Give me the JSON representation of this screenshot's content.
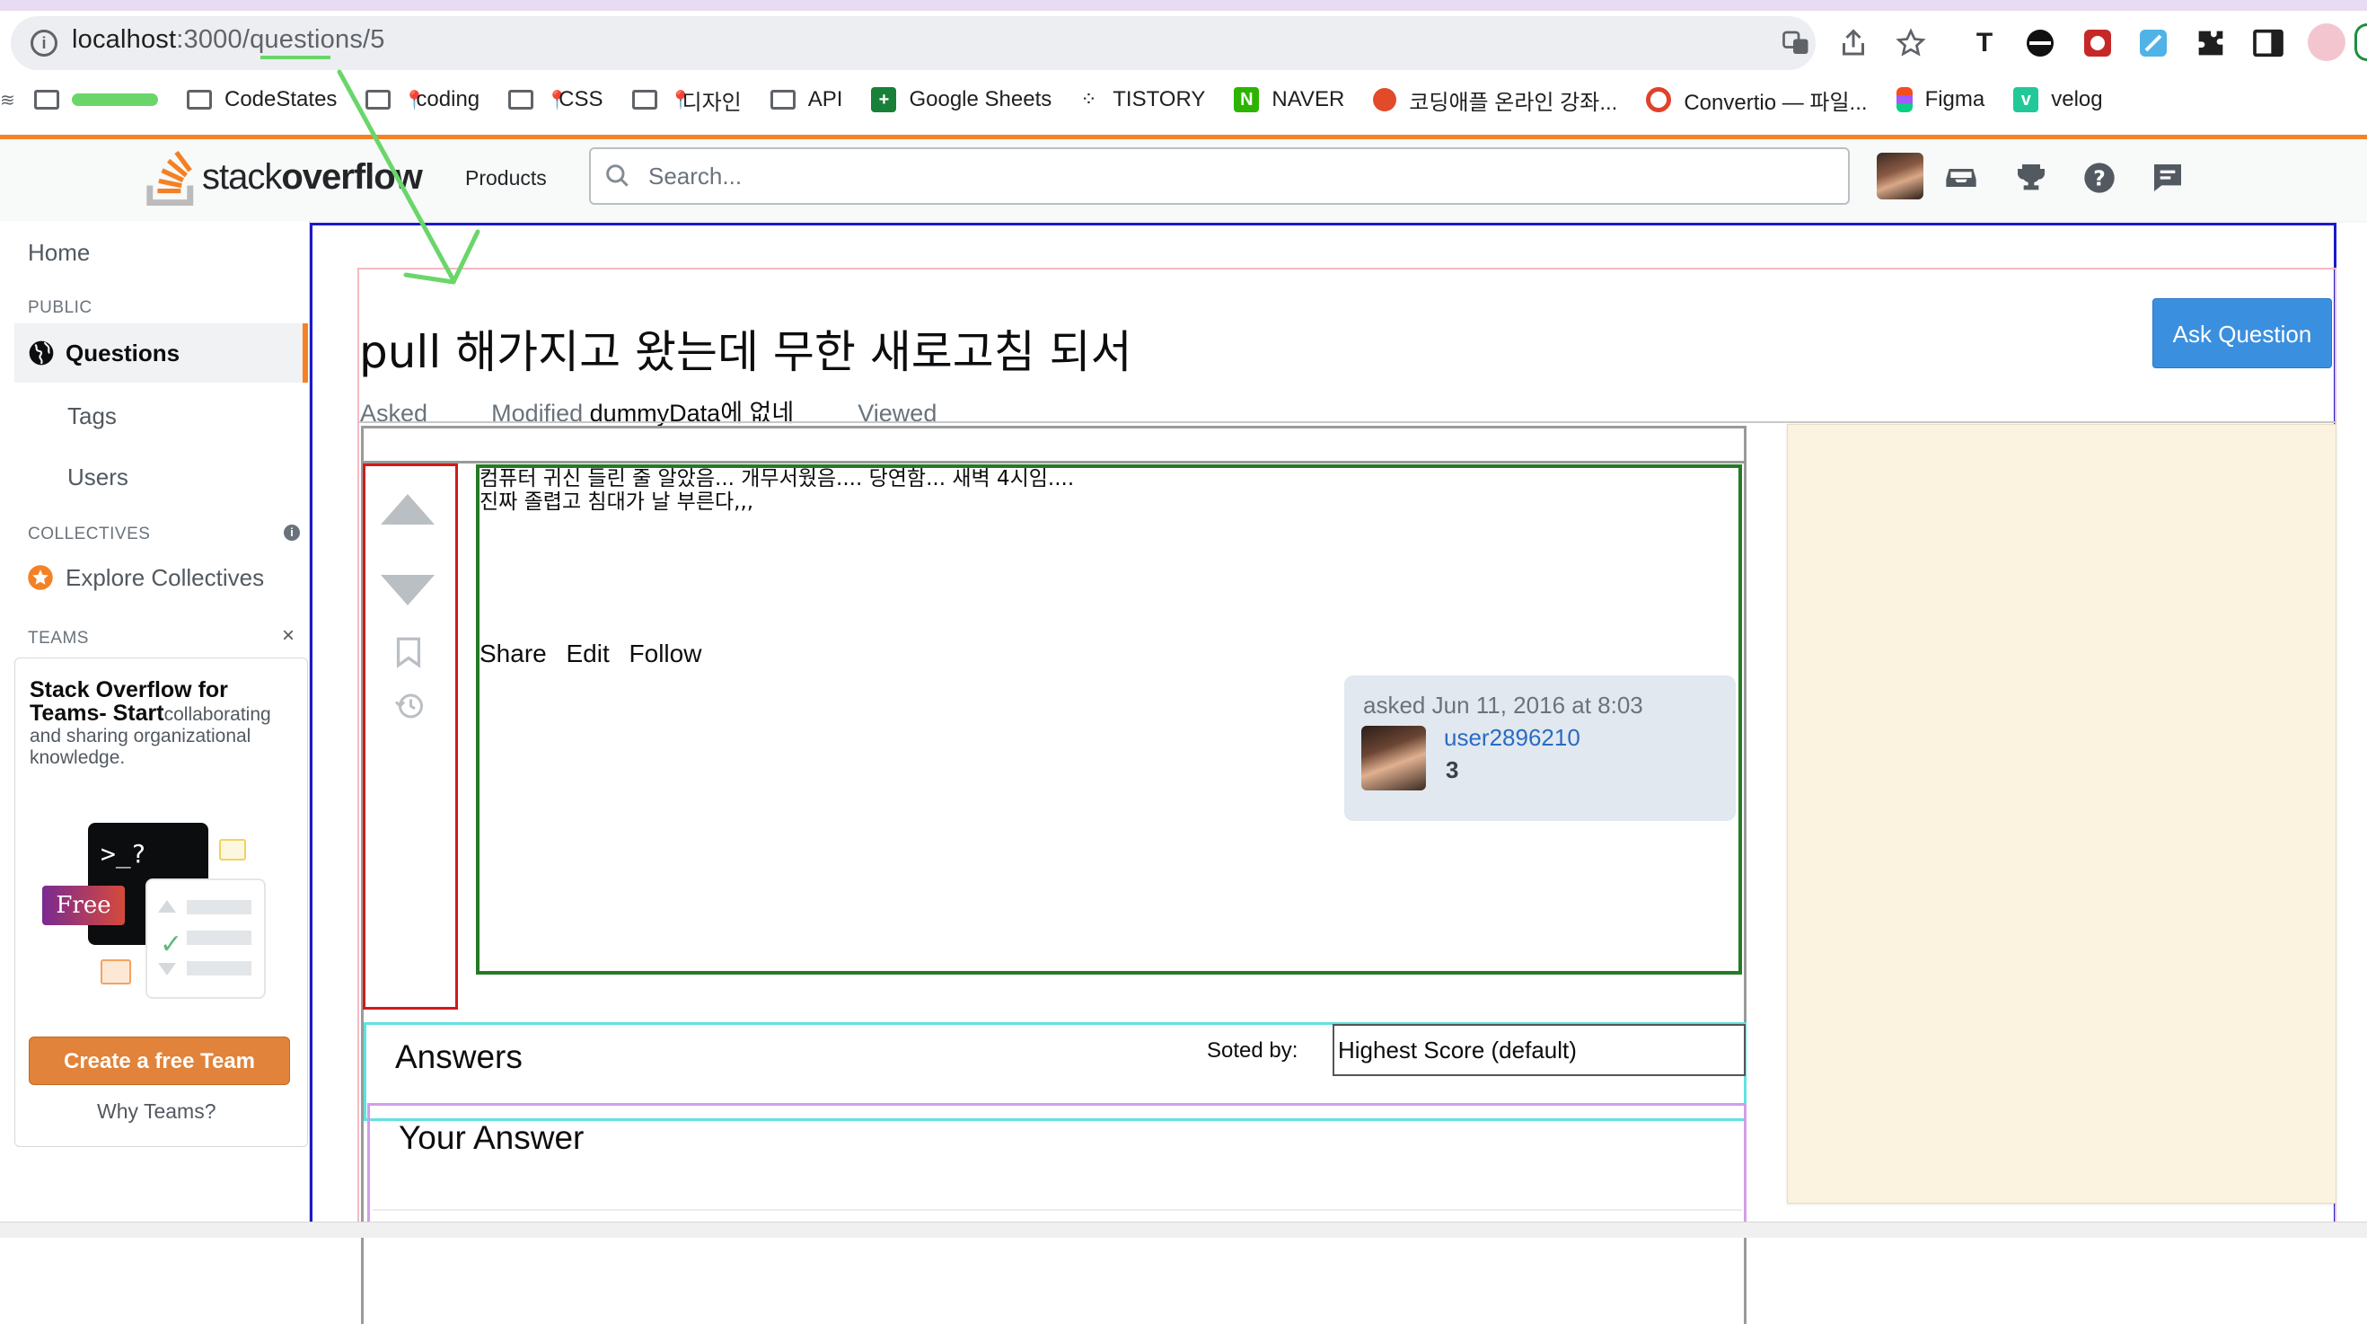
{
  "browser": {
    "url_host": "localhost",
    "url_rest": ":3000/questions/5",
    "bookmarks": [
      {
        "label": "",
        "icon": "folder-icon"
      },
      {
        "label": "CodeStates",
        "icon": "folder-icon"
      },
      {
        "label": "coding",
        "icon": "folder-pin-icon"
      },
      {
        "label": "CSS",
        "icon": "folder-pin-icon"
      },
      {
        "label": "디자인",
        "icon": "folder-pin-icon"
      },
      {
        "label": "API",
        "icon": "folder-icon"
      },
      {
        "label": "Google Sheets",
        "icon": "sheets-icon"
      },
      {
        "label": "TISTORY",
        "icon": "tistory-icon"
      },
      {
        "label": "NAVER",
        "icon": "naver-icon"
      },
      {
        "label": "코딩애플 온라인 강좌...",
        "icon": "apple-icon"
      },
      {
        "label": "Convertio — 파일...",
        "icon": "convertio-icon"
      },
      {
        "label": "Figma",
        "icon": "figma-icon"
      },
      {
        "label": "velog",
        "icon": "velog-icon"
      }
    ]
  },
  "header": {
    "logo_light": "stack",
    "logo_bold": "overflow",
    "products": "Products",
    "search_placeholder": "Search..."
  },
  "sidebar": {
    "home": "Home",
    "public_label": "PUBLIC",
    "questions": "Questions",
    "tags": "Tags",
    "users": "Users",
    "collectives_label": "COLLECTIVES",
    "explore_collectives": "Explore Collectives",
    "teams_label": "TEAMS",
    "teams_title": "Stack Overflow for Teams",
    "teams_dash": "- Start",
    "teams_desc": "collaborating and sharing organizational knowledge.",
    "free_badge": "Free",
    "terminal_prompt": ">_?",
    "create_team": "Create a free Team",
    "why_teams": "Why Teams?"
  },
  "question": {
    "title": "pull 해가지고 왔는데 무한 새로고침 되서",
    "ask_button": "Ask Question",
    "asked_label": "Asked",
    "modified_label": "Modified",
    "modified_value": "dummyData에 없네",
    "viewed_label": "Viewed",
    "body_line1": "컴퓨터 귀신 들린 줄 알았음... 개무서웠음.... 당연함... 새벽 4시임....",
    "body_line2": "진짜 졸렵고 침대가 날 부른다,,,",
    "share": "Share",
    "edit": "Edit",
    "follow": "Follow",
    "asked_date": "asked Jun 11, 2016 at 8:03",
    "user_name": "user2896210",
    "user_rep": "3"
  },
  "answers": {
    "title": "Answers",
    "sorted_label": "Soted by:",
    "sort_value": "Highest Score (default)",
    "your_answer": "Your Answer"
  },
  "colors": {
    "accent": "#f48225",
    "ask_button": "#3b8fdf",
    "user_link": "#2a6bc2",
    "create_team": "#e1833a"
  }
}
